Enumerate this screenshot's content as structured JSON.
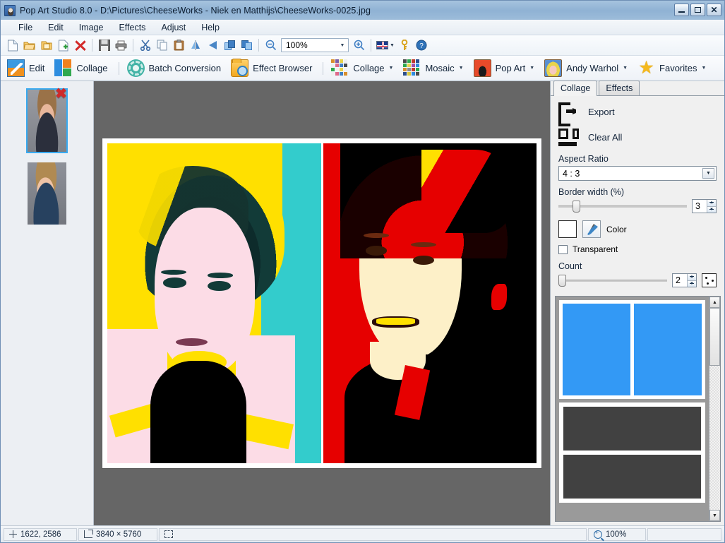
{
  "window": {
    "title": "Pop Art Studio 8.0 - D:\\Pictures\\CheeseWorks - Niek en Matthijs\\CheeseWorks-0025.jpg",
    "app_icon": "app-portrait-icon",
    "minimize_label": "_",
    "maximize_label": "",
    "close_label": "✕"
  },
  "menu": {
    "items": [
      {
        "label": "File"
      },
      {
        "label": "Edit"
      },
      {
        "label": "Image"
      },
      {
        "label": "Effects"
      },
      {
        "label": "Adjust"
      },
      {
        "label": "Help"
      }
    ]
  },
  "toolbar": {
    "zoom_value": "100%",
    "items": [
      {
        "name": "new-file-icon"
      },
      {
        "name": "open-folder-icon"
      },
      {
        "name": "open-recent-icon"
      },
      {
        "name": "add-file-icon"
      },
      {
        "name": "delete-icon"
      },
      {
        "name": "save-icon"
      },
      {
        "name": "print-icon"
      },
      {
        "name": "cut-icon"
      },
      {
        "name": "copy-icon"
      },
      {
        "name": "paste-icon"
      },
      {
        "name": "flip-horizontal-icon"
      },
      {
        "name": "flip-vertical-icon"
      },
      {
        "name": "rotate-left-icon"
      },
      {
        "name": "rotate-right-icon"
      },
      {
        "name": "zoom-out-icon"
      },
      {
        "name": "zoom-in-icon"
      },
      {
        "name": "language-flag-icon"
      },
      {
        "name": "key-icon"
      },
      {
        "name": "help-icon"
      }
    ]
  },
  "toolbar2": {
    "buttons": [
      {
        "label": "Edit",
        "icon": "edit-icon",
        "dropdown": false
      },
      {
        "label": "Collage",
        "icon": "collage-squares-icon",
        "dropdown": false
      },
      {
        "label": "Batch Conversion",
        "icon": "gear-icon",
        "dropdown": false
      },
      {
        "label": "Effect Browser",
        "icon": "folder-search-icon",
        "dropdown": false
      },
      {
        "label": "Collage",
        "icon": "collage-mosaic-icon",
        "dropdown": true
      },
      {
        "label": "Mosaic",
        "icon": "mosaic-grid-icon",
        "dropdown": true
      },
      {
        "label": "Pop Art",
        "icon": "pop-art-portrait-icon",
        "dropdown": true
      },
      {
        "label": "Andy Warhol",
        "icon": "warhol-portrait-icon",
        "dropdown": true
      },
      {
        "label": "Favorites",
        "icon": "star-icon",
        "dropdown": true
      }
    ],
    "dropdown_caret": "▾"
  },
  "filmstrip": {
    "thumbnails": [
      {
        "name": "thumbnail-1",
        "selected": true,
        "delete_label": "✖"
      },
      {
        "name": "thumbnail-2",
        "selected": false,
        "delete_label": ""
      }
    ]
  },
  "canvas": {
    "background_color": "#666666",
    "panels": [
      {
        "name": "pop-art-panel-left",
        "style": "yellow-cyan-pink"
      },
      {
        "name": "pop-art-panel-right",
        "style": "red-black-cream"
      }
    ]
  },
  "sidepanel": {
    "tabs": [
      {
        "label": "Collage",
        "active": true
      },
      {
        "label": "Effects",
        "active": false
      }
    ],
    "export_label": "Export",
    "clear_all_label": "Clear All",
    "aspect_ratio_label": "Aspect Ratio",
    "aspect_ratio_value": "4 : 3",
    "border_width_label": "Border width (%)",
    "border_width_value": "3",
    "color_label": "Color",
    "color_value": "#ffffff",
    "transparent_label": "Transparent",
    "transparent_checked": false,
    "count_label": "Count",
    "count_value": "2",
    "dropdown_arrow": "▼",
    "spin_up": "▲",
    "spin_down": "▼",
    "scroll_up": "▲",
    "scroll_down": "▼",
    "templates": [
      {
        "name": "template-two-vertical",
        "selected": true,
        "cells": 2,
        "cell_color": "#3399f5"
      },
      {
        "name": "template-horizontal-bands",
        "selected": false,
        "cells": 2,
        "cell_color": "#414141"
      }
    ]
  },
  "statusbar": {
    "cursor_position": "1622, 2586",
    "image_dimensions": "3840 × 5760",
    "selection": "",
    "zoom": "100%",
    "extra": ""
  }
}
